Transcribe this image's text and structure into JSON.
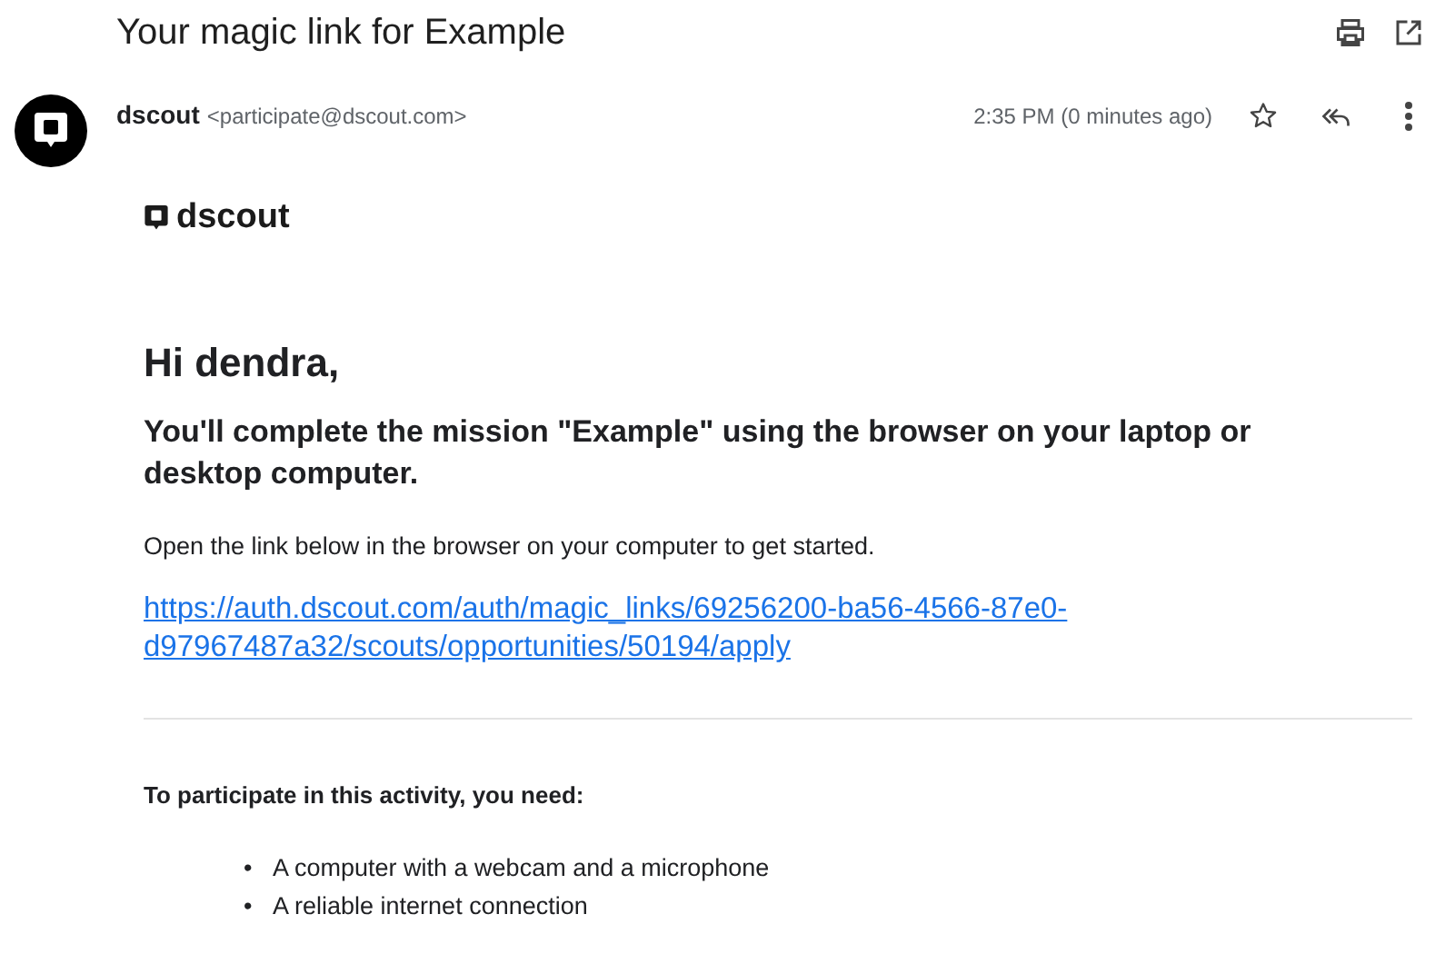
{
  "subject": "Your magic link for Example",
  "sender": {
    "name": "dscout",
    "email": "<participate@dscout.com>",
    "time": "2:35 PM (0 minutes ago)",
    "starred": false
  },
  "body": {
    "logo_text": "dscout",
    "greeting": "Hi dendra,",
    "headline": "You'll complete the mission \"Example\" using the browser on your laptop or desktop computer.",
    "instruction": "Open the link below in the browser on your computer to get started.",
    "link": "https://auth.dscout.com/auth/magic_links/69256200-ba56-4566-87e0-d97967487a32/scouts/opportunities/50194/apply",
    "requirements_title": "To participate in this activity, you need:",
    "requirements": [
      {
        "marker": "•",
        "text": "A computer with a webcam and a microphone"
      },
      {
        "marker": "•",
        "text": "A reliable internet connection"
      }
    ]
  }
}
